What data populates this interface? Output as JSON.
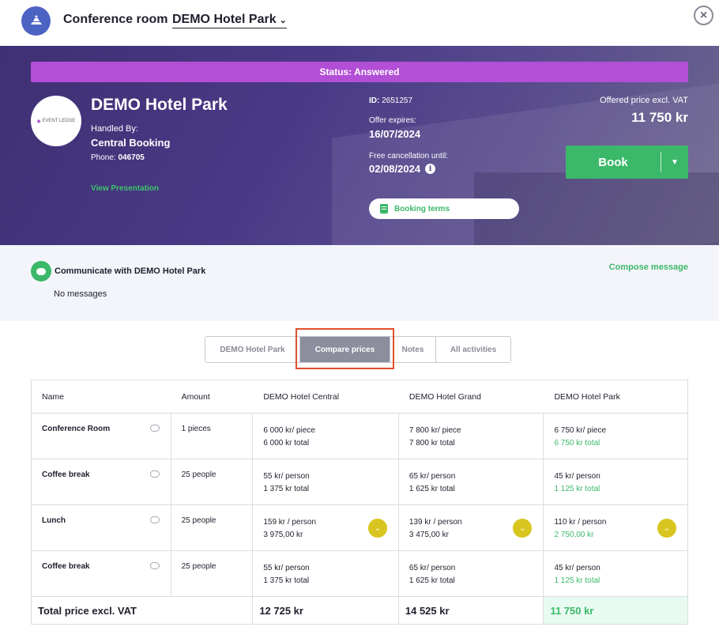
{
  "topbar": {
    "title": "Conference room",
    "venue_select": "DEMO Hotel Park",
    "close_icon": "close-icon"
  },
  "hero": {
    "status": "Status: Answered",
    "venue_name": "DEMO Hotel Park",
    "logo_text": "EVENT LEDGE",
    "handled_by_label": "Handled By:",
    "handled_by": "Central Booking",
    "phone_label": "Phone:",
    "phone": "046705",
    "view_presentation": "View Presentation",
    "id_label": "ID:",
    "id": "2651257",
    "offer_expires_label": "Offer expires:",
    "offer_expires": "16/07/2024",
    "free_cancellation_label": "Free cancellation until:",
    "free_cancellation": "02/08/2024",
    "booking_terms": "Booking terms",
    "offered_price_label": "Offered price excl. VAT",
    "offered_price": "11 750 kr",
    "book_label": "Book"
  },
  "communicate": {
    "title": "Communicate with DEMO Hotel Park",
    "no_messages": "No messages",
    "compose": "Compose message"
  },
  "tabs": [
    {
      "label": "DEMO Hotel Park",
      "active": false
    },
    {
      "label": "Compare prices",
      "active": true
    },
    {
      "label": "Notes",
      "active": false
    },
    {
      "label": "All activities",
      "active": false
    }
  ],
  "table": {
    "headers": [
      "Name",
      "Amount",
      "DEMO Hotel Central",
      "DEMO Hotel Grand",
      "DEMO Hotel Park"
    ],
    "rows": [
      {
        "name": "Conference Room",
        "amount": "1 pieces",
        "central": [
          "6 000 kr/ piece",
          "6 000 kr total"
        ],
        "grand": [
          "7 800 kr/ piece",
          "7 800 kr total"
        ],
        "park": [
          "6 750 kr/ piece",
          "6 750 kr total"
        ]
      },
      {
        "name": "Coffee break",
        "amount": "25 people",
        "central": [
          "55 kr/ person",
          "1 375 kr total"
        ],
        "grand": [
          "65 kr/ person",
          "1 625 kr total"
        ],
        "park": [
          "45 kr/ person",
          "1 125 kr total"
        ]
      },
      {
        "name": "Lunch",
        "amount": "25 people",
        "central": [
          "159 kr / person",
          "3 975,00 kr"
        ],
        "grand": [
          "139 kr / person",
          "3 475,00 kr"
        ],
        "park": [
          "110 kr / person",
          "2 750,00 kr"
        ]
      },
      {
        "name": "Coffee break",
        "amount": "25 people",
        "central": [
          "55 kr/ person",
          "1 375 kr total"
        ],
        "grand": [
          "65 kr/ person",
          "1 625 kr total"
        ],
        "park": [
          "45 kr/ person",
          "1 125 kr total"
        ]
      }
    ],
    "total": {
      "label": "Total price excl. VAT",
      "central": "12 725 kr",
      "grand": "14 525 kr",
      "park": "11 750 kr"
    }
  },
  "colors": {
    "accent_green": "#3cb86a",
    "status_purple": "#b24fd6",
    "hero_purple": "#4a3a86",
    "highlight_red": "#e0512c",
    "dropdown_yellow": "#d8c51f"
  }
}
